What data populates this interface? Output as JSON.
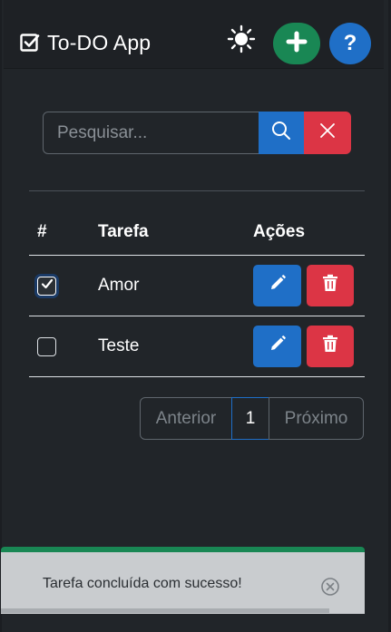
{
  "navbar": {
    "brand_title": "To-DO App",
    "icons": {
      "brand": "check-square-icon",
      "theme": "sun-icon",
      "add": "plus-icon",
      "help": "question-icon"
    },
    "help_label": "?"
  },
  "search": {
    "placeholder": "Pesquisar...",
    "value": "",
    "search_icon": "search-icon",
    "clear_icon": "close-icon"
  },
  "table": {
    "headers": [
      "#",
      "Tarefa",
      "Ações"
    ],
    "rows": [
      {
        "checked": true,
        "task": "Amor"
      },
      {
        "checked": false,
        "task": "Teste"
      }
    ]
  },
  "pagination": {
    "prev": "Anterior",
    "current": "1",
    "next": "Próximo"
  },
  "toast": {
    "message": "Tarefa concluída com sucesso!",
    "status": "success"
  },
  "colors": {
    "background": "#212529",
    "primary": "#1f6fc7",
    "success": "#198754",
    "danger": "#dc3545"
  }
}
